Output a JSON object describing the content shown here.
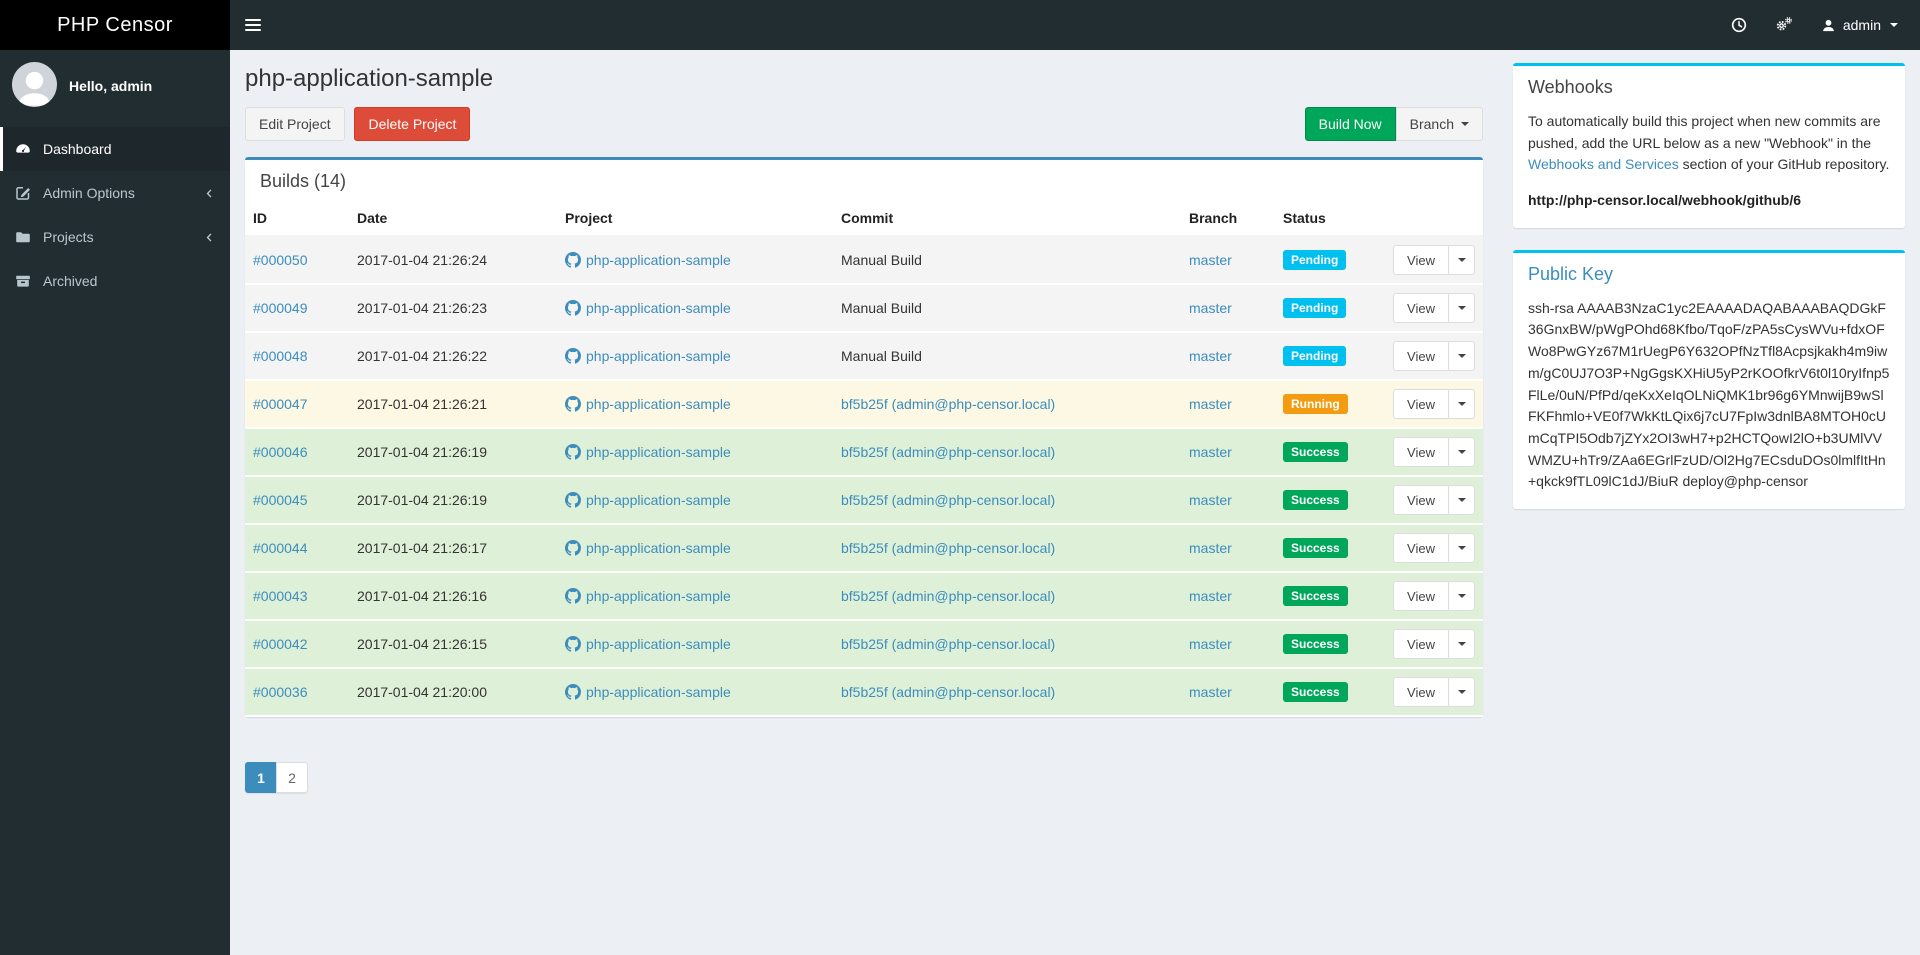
{
  "navbar": {
    "brand": "PHP Censor",
    "user_label": "admin",
    "icons": [
      "clock-icon",
      "cogs-icon",
      "user-icon"
    ]
  },
  "sidebar": {
    "greeting": "Hello, admin",
    "items": [
      {
        "label": "Dashboard",
        "icon": "dashboard-icon",
        "active": true,
        "has_submenu": false
      },
      {
        "label": "Admin Options",
        "icon": "edit-icon",
        "active": false,
        "has_submenu": true
      },
      {
        "label": "Projects",
        "icon": "folder-icon",
        "active": false,
        "has_submenu": true
      },
      {
        "label": "Archived",
        "icon": "archive-icon",
        "active": false,
        "has_submenu": false
      }
    ]
  },
  "page": {
    "title": "php-application-sample",
    "edit_label": "Edit Project",
    "delete_label": "Delete Project",
    "build_now_label": "Build Now",
    "branch_label": "Branch"
  },
  "builds": {
    "panel_title": "Builds (14)",
    "columns": [
      "ID",
      "Date",
      "Project",
      "Commit",
      "Branch",
      "Status"
    ],
    "view_label": "View",
    "rows": [
      {
        "id": "#000050",
        "date": "2017-01-04 21:26:24",
        "project": "php-application-sample",
        "commit": "Manual Build",
        "commit_link": false,
        "branch": "master",
        "status": "Pending"
      },
      {
        "id": "#000049",
        "date": "2017-01-04 21:26:23",
        "project": "php-application-sample",
        "commit": "Manual Build",
        "commit_link": false,
        "branch": "master",
        "status": "Pending"
      },
      {
        "id": "#000048",
        "date": "2017-01-04 21:26:22",
        "project": "php-application-sample",
        "commit": "Manual Build",
        "commit_link": false,
        "branch": "master",
        "status": "Pending"
      },
      {
        "id": "#000047",
        "date": "2017-01-04 21:26:21",
        "project": "php-application-sample",
        "commit": "bf5b25f (admin@php-censor.local)",
        "commit_link": true,
        "branch": "master",
        "status": "Running"
      },
      {
        "id": "#000046",
        "date": "2017-01-04 21:26:19",
        "project": "php-application-sample",
        "commit": "bf5b25f (admin@php-censor.local)",
        "commit_link": true,
        "branch": "master",
        "status": "Success"
      },
      {
        "id": "#000045",
        "date": "2017-01-04 21:26:19",
        "project": "php-application-sample",
        "commit": "bf5b25f (admin@php-censor.local)",
        "commit_link": true,
        "branch": "master",
        "status": "Success"
      },
      {
        "id": "#000044",
        "date": "2017-01-04 21:26:17",
        "project": "php-application-sample",
        "commit": "bf5b25f (admin@php-censor.local)",
        "commit_link": true,
        "branch": "master",
        "status": "Success"
      },
      {
        "id": "#000043",
        "date": "2017-01-04 21:26:16",
        "project": "php-application-sample",
        "commit": "bf5b25f (admin@php-censor.local)",
        "commit_link": true,
        "branch": "master",
        "status": "Success"
      },
      {
        "id": "#000042",
        "date": "2017-01-04 21:26:15",
        "project": "php-application-sample",
        "commit": "bf5b25f (admin@php-censor.local)",
        "commit_link": true,
        "branch": "master",
        "status": "Success"
      },
      {
        "id": "#000036",
        "date": "2017-01-04 21:20:00",
        "project": "php-application-sample",
        "commit": "bf5b25f (admin@php-censor.local)",
        "commit_link": true,
        "branch": "master",
        "status": "Success"
      }
    ]
  },
  "pagination": {
    "pages": [
      {
        "label": "1",
        "active": true
      },
      {
        "label": "2",
        "active": false
      }
    ]
  },
  "webhooks": {
    "title": "Webhooks",
    "text_before": "To automatically build this project when new commits are pushed, add the URL below as a new \"Webhook\" in the ",
    "link_text": "Webhooks and Services",
    "text_after": " section of your GitHub repository.",
    "url": "http://php-censor.local/webhook/github/6"
  },
  "public_key": {
    "title": "Public Key",
    "key": "ssh-rsa AAAAB3NzaC1yc2EAAAADAQABAAABAQDGkF36GnxBW/pWgPOhd68Kfbo/TqoF/zPA5sCysWVu+fdxOFWo8PwGYz67M1rUegP6Y632OPfNzTfl8Acpsjkakh4m9iwm/gC0UJ7O3P+NgGgsKXHiU5yP2rKOOfkrV6t0l10ryIfnp5FlLe/0uN/PfPd/qeKxXeIqOLNiQMK1br96g6YMnwijB9wSlFKFhmlo+VE0f7WkKtLQix6j7cU7FpIw3dnlBA8MTOH0cUmCqTPI5Odb7jZYx2OI3wH7+p2HCTQowI2lO+b3UMlVVWMZU+hTr9/ZAa6EGrlFzUD/Ol2Hg7ECsduDOs0lmlfItHn+qkck9fTL09lC1dJ/BiuR deploy@php-censor"
  },
  "colors": {
    "navbar_bg": "#222d32",
    "logo_bg": "#000000",
    "sidebar_bg": "#222d32",
    "sidebar_active_bg": "#1e282c",
    "content_bg": "#ecf0f5",
    "link": "#3c8dbc",
    "panel_accent_primary": "#3c8dbc",
    "panel_accent_info": "#00c0ef",
    "status_pending": "#00c0ef",
    "status_running": "#f39c12",
    "status_success": "#00a65a",
    "row_pending": "#f4f4f4",
    "row_running": "#fcf8e3",
    "row_success": "#dff0d8",
    "btn_danger": "#dd4b39",
    "btn_success": "#00a65a"
  }
}
